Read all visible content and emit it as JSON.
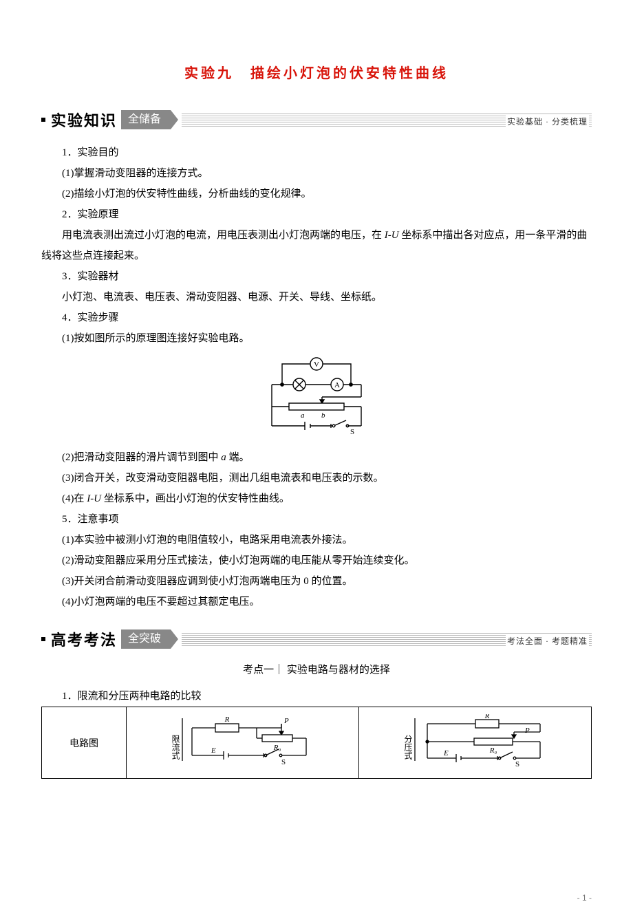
{
  "title": "实验九　描绘小灯泡的伏安特性曲线",
  "section1": {
    "heading": "实验知识",
    "tab": "全储备",
    "note": "实验基础 · 分类梳理"
  },
  "body": {
    "s1": "1．实验目的",
    "s1_1": "(1)掌握滑动变阻器的连接方式。",
    "s1_2": "(2)描绘小灯泡的伏安特性曲线，分析曲线的变化规律。",
    "s2": "2．实验原理",
    "s2_1a": "用电流表测出流过小灯泡的电流，用电压表测出小灯泡两端的电压，在 ",
    "s2_1b": "I-U",
    "s2_1c": " 坐标系中描出各对应点，用一条平滑的曲线将这些点连接起来。",
    "s3": "3．实验器材",
    "s3_1": "小灯泡、电流表、电压表、滑动变阻器、电源、开关、导线、坐标纸。",
    "s4": "4．实验步骤",
    "s4_1": "(1)按如图所示的原理图连接好实验电路。",
    "s4_2a": "(2)把滑动变阻器的滑片调节到图中 ",
    "s4_2b": "a",
    "s4_2c": " 端。",
    "s4_3": "(3)闭合开关，改变滑动变阻器电阻，测出几组电流表和电压表的示数。",
    "s4_4a": "(4)在 ",
    "s4_4b": "I-U",
    "s4_4c": " 坐标系中，画出小灯泡的伏安特性曲线。",
    "s5": "5．注意事项",
    "s5_1": "(1)本实验中被测小灯泡的电阻值较小，电路采用电流表外接法。",
    "s5_2": "(2)滑动变阻器应采用分压式接法，使小灯泡两端的电压能从零开始连续变化。",
    "s5_3": "(3)开关闭合前滑动变阻器应调到使小灯泡两端电压为 0 的位置。",
    "s5_4": "(4)小灯泡两端的电压不要超过其额定电压。"
  },
  "section2": {
    "heading": "高考考法",
    "tab": "全突破",
    "note": "考法全面 · 考题精准"
  },
  "sub1": "考点一｜ 实验电路与器材的选择",
  "sub1_p1": "1．限流和分压两种电路的比较",
  "table": {
    "h1": "电路图",
    "c1_label": "限流式",
    "c2_label": "分压式"
  },
  "circuit": {
    "labels": {
      "V": "V",
      "A": "A",
      "a": "a",
      "b": "b",
      "S": "S"
    }
  },
  "tcirc": {
    "R": "R",
    "P": "P",
    "R0": "R₀",
    "E": "E",
    "S": "S"
  },
  "page_num": "- 1 -"
}
